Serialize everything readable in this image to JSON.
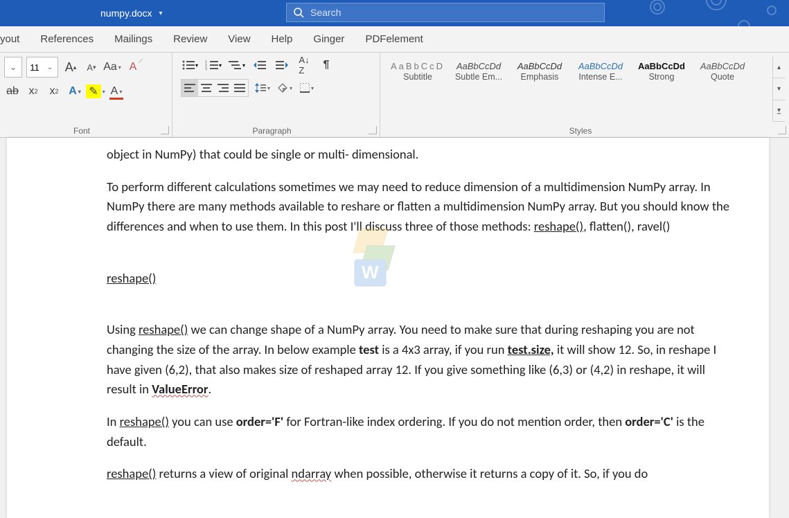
{
  "title": {
    "filename": "numpy.docx"
  },
  "search": {
    "placeholder": "Search"
  },
  "tabs": [
    "yout",
    "References",
    "Mailings",
    "Review",
    "View",
    "Help",
    "Ginger",
    "PDFelement"
  ],
  "font": {
    "size": "11",
    "group_label": "Font"
  },
  "paragraph": {
    "group_label": "Paragraph"
  },
  "styles": {
    "group_label": "Styles",
    "items": [
      {
        "preview": "AaBbCcD",
        "name": "Subtitle",
        "color": "#7b7b7b",
        "spacing": "3px",
        "bold": false,
        "italic": false
      },
      {
        "preview": "AaBbCcDd",
        "name": "Subtle Em...",
        "color": "#4a4a4a",
        "spacing": "0",
        "bold": false,
        "italic": true
      },
      {
        "preview": "AaBbCcDd",
        "name": "Emphasis",
        "color": "#333",
        "spacing": "0",
        "bold": false,
        "italic": true
      },
      {
        "preview": "AaBbCcDd",
        "name": "Intense E...",
        "color": "#2e74b5",
        "spacing": "0",
        "bold": false,
        "italic": true
      },
      {
        "preview": "AaBbCcDd",
        "name": "Strong",
        "color": "#111",
        "spacing": "0",
        "bold": true,
        "italic": false
      },
      {
        "preview": "AaBbCcDd",
        "name": "Quote",
        "color": "#555",
        "spacing": "0",
        "bold": false,
        "italic": true
      }
    ]
  },
  "document": {
    "p1": "object in NumPy) that could be single or multi- dimensional.",
    "p2_a": "To perform different calculations sometimes we may need to reduce dimension of a multidimension NumPy array. In NumPy there are many methods available to reshare or flatten a multidimension NumPy array. But you should know the differences and when to use them. In this post I'll discuss three of those methods: ",
    "p2_b": "reshape()",
    "p2_c": ", flatten(), ravel()",
    "h_reshape": "reshape()",
    "p3_a": "Using ",
    "p3_b": "reshape()",
    "p3_c": " we can change shape of  a NumPy array. You need to make sure that during reshaping you are not changing the size of the array. In below example ",
    "p3_d": "test",
    "p3_e": " is a 4x3 array, if you run ",
    "p3_f": "test.size,",
    "p3_g": " it will show 12. So, in reshape I have given (6,2), that also makes size of reshaped array 12.  If you give something like (6,3) or (4,2) in reshape, it will result in ",
    "p3_h": "ValueError",
    "p3_i": ".",
    "p4_a": "In ",
    "p4_b": "reshape()",
    "p4_c": " you can use ",
    "p4_d": "order='F'",
    "p4_e": " for Fortran-like index ordering. If you do not mention order, then ",
    "p4_f": "order='C'",
    "p4_g": " is the default.",
    "p5_a": "reshape()",
    "p5_b": " returns a view of original ",
    "p5_c": "ndarray",
    "p5_d": " when possible, otherwise it returns a copy of it. So, if you do"
  }
}
